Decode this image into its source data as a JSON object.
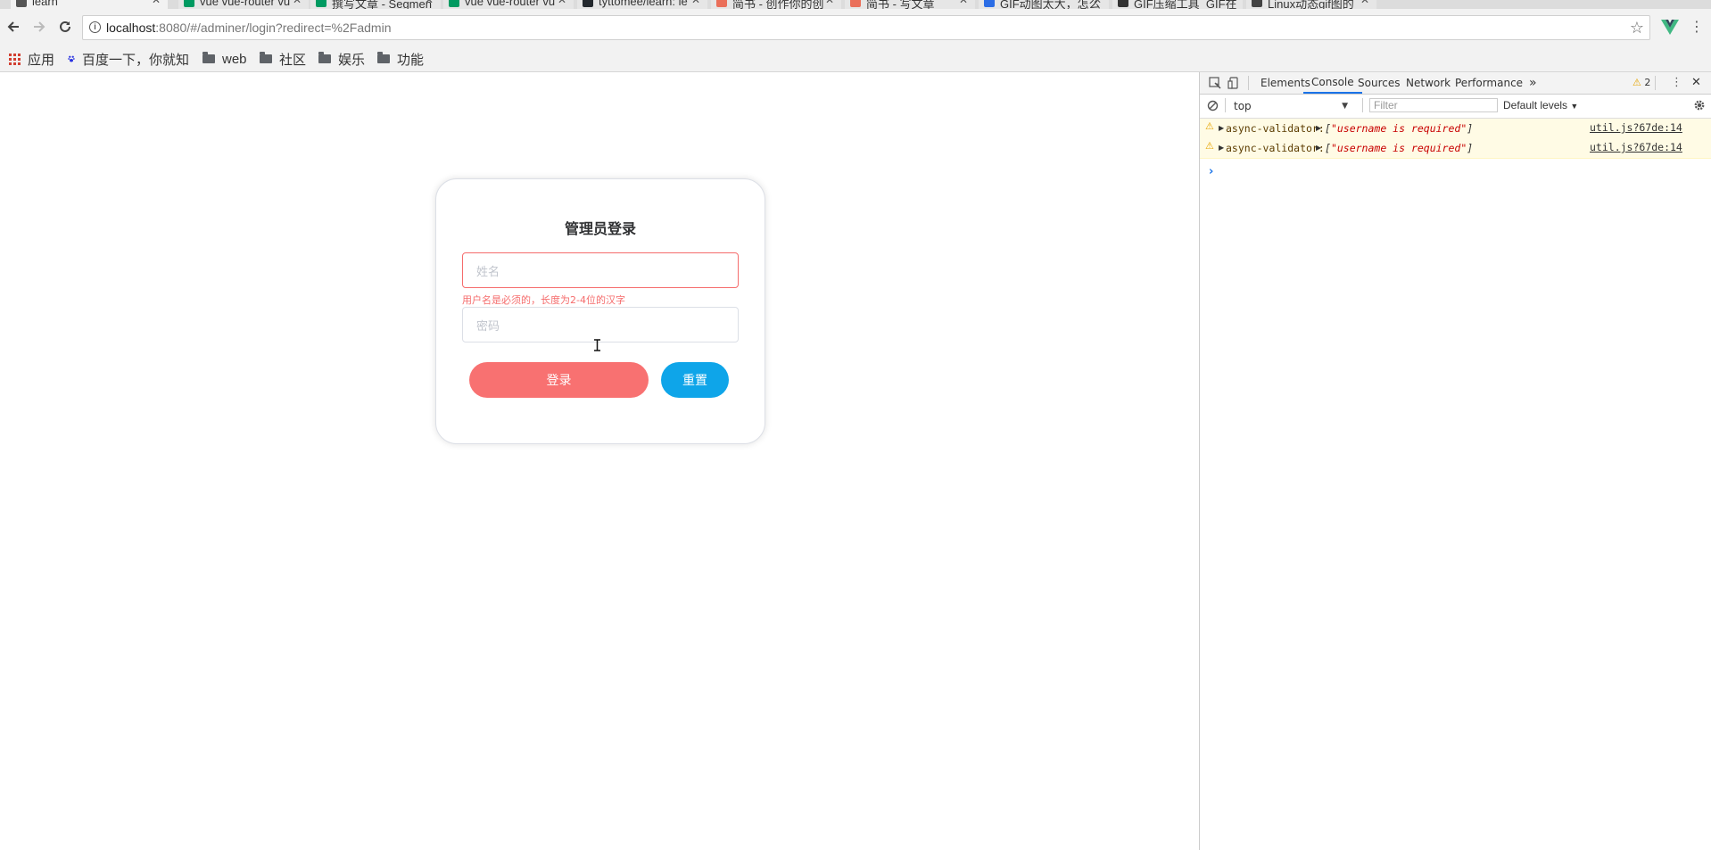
{
  "browser": {
    "tabs": [
      {
        "title": "learn",
        "favicon_color": "#555555",
        "active": true
      },
      {
        "title": "vue vue-router vu",
        "favicon_color": "#009a61",
        "active": false
      },
      {
        "title": "撰写文章 - Segmen",
        "favicon_color": "#009a61",
        "active": false
      },
      {
        "title": "vue vue-router vu",
        "favicon_color": "#009a61",
        "active": false
      },
      {
        "title": "tyttomee/learn: le",
        "favicon_color": "#24292e",
        "active": false
      },
      {
        "title": "简书 - 创作你的创",
        "favicon_color": "#ea6f5a",
        "active": false
      },
      {
        "title": "简书 - 写文章",
        "favicon_color": "#ea6f5a",
        "active": false
      },
      {
        "title": "GIF动图太大，怎么",
        "favicon_color": "#2b6de5",
        "active": false
      },
      {
        "title": "GIF压缩工具_GIF在",
        "favicon_color": "#333333",
        "active": false
      },
      {
        "title": "Linux动态gif图的",
        "favicon_color": "#444444",
        "active": false
      }
    ],
    "url_host": "localhost",
    "url_rest": ":8080/#/adminer/login?redirect=%2Fadmin",
    "bookmarks": {
      "apps": "应用",
      "baidu": "百度一下，你就知",
      "web": "web",
      "community": "社区",
      "entertainment": "娱乐",
      "features": "功能"
    }
  },
  "login": {
    "title": "管理员登录",
    "username_placeholder": "姓名",
    "username_error": "用户名是必须的，长度为2-4位的汉字",
    "password_placeholder": "密码",
    "login_button": "登录",
    "reset_button": "重置",
    "colors": {
      "login": "#f87171",
      "reset": "#0ea5e9",
      "error": "#f56c6c"
    }
  },
  "devtools": {
    "tabs": [
      "Elements",
      "Console",
      "Sources",
      "Network",
      "Performance"
    ],
    "active_tab": "Console",
    "more": "»",
    "warning_count": "2",
    "context": "top",
    "filter_placeholder": "Filter",
    "levels": "Default levels",
    "messages": [
      {
        "source": "async-validator:",
        "open": "[",
        "value": "\"username is required\"",
        "close": "]",
        "link": "util.js?67de:14"
      },
      {
        "source": "async-validator:",
        "open": "[",
        "value": "\"username is required\"",
        "close": "]",
        "link": "util.js?67de:14"
      }
    ],
    "prompt": "›"
  }
}
